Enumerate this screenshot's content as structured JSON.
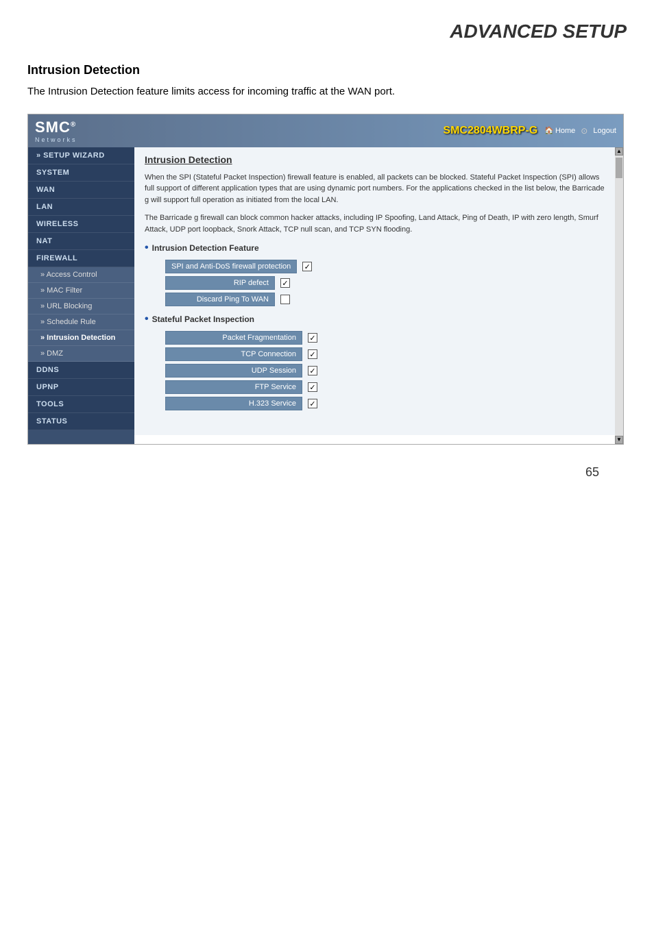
{
  "page": {
    "title": "ADVANCED SETUP",
    "number": "65"
  },
  "intro": {
    "heading": "Intrusion Detection",
    "body": "The Intrusion Detection feature limits access for incoming traffic at the WAN port."
  },
  "router": {
    "brand": "SMC",
    "brand_sup": "®",
    "networks": "Networks",
    "model": "SMC2804WBRP-G",
    "nav_home": "Home",
    "nav_logout": "Logout"
  },
  "sidebar": {
    "items": [
      {
        "id": "setup-wizard",
        "label": "» SETUP WIZARD",
        "type": "section"
      },
      {
        "id": "system",
        "label": "SYSTEM",
        "type": "section"
      },
      {
        "id": "wan",
        "label": "WAN",
        "type": "section"
      },
      {
        "id": "lan",
        "label": "LAN",
        "type": "section"
      },
      {
        "id": "wireless",
        "label": "WIRELESS",
        "type": "section"
      },
      {
        "id": "nat",
        "label": "NAT",
        "type": "section"
      },
      {
        "id": "firewall",
        "label": "FIREWALL",
        "type": "section"
      },
      {
        "id": "access-control",
        "label": "» Access Control",
        "type": "sub"
      },
      {
        "id": "mac-filter",
        "label": "» MAC Filter",
        "type": "sub"
      },
      {
        "id": "url-blocking",
        "label": "» URL Blocking",
        "type": "sub"
      },
      {
        "id": "schedule-rule",
        "label": "» Schedule Rule",
        "type": "sub"
      },
      {
        "id": "intrusion-detection",
        "label": "» Intrusion Detection",
        "type": "sub",
        "active": true
      },
      {
        "id": "dmz",
        "label": "» DMZ",
        "type": "sub"
      },
      {
        "id": "ddns",
        "label": "DDNS",
        "type": "section"
      },
      {
        "id": "upnp",
        "label": "UPnP",
        "type": "section"
      },
      {
        "id": "tools",
        "label": "TOOLS",
        "type": "section"
      },
      {
        "id": "status",
        "label": "STATUS",
        "type": "section"
      }
    ]
  },
  "content": {
    "title": "Intrusion Detection",
    "description1": "When the SPI (Stateful Packet Inspection) firewall feature is enabled, all packets can be blocked. Stateful Packet Inspection (SPI) allows full support of different application types that are using dynamic port numbers. For the applications checked in the list below, the Barricade g will support full operation as initiated from the local LAN.",
    "description2": "The Barricade g firewall can block common hacker attacks, including IP Spoofing, Land Attack, Ping of Death, IP with zero length, Smurf Attack, UDP port loopback, Snork Attack, TCP null scan, and TCP SYN flooding.",
    "section1": {
      "title": "Intrusion Detection Feature",
      "fields": [
        {
          "id": "spi-antidos",
          "label": "SPI and Anti-DoS firewall protection",
          "checked": true
        },
        {
          "id": "rip-defect",
          "label": "RIP defect",
          "checked": true
        },
        {
          "id": "discard-ping",
          "label": "Discard Ping To WAN",
          "checked": false
        }
      ]
    },
    "section2": {
      "title": "Stateful Packet Inspection",
      "fields": [
        {
          "id": "packet-frag",
          "label": "Packet Fragmentation",
          "checked": true
        },
        {
          "id": "tcp-conn",
          "label": "TCP Connection",
          "checked": true
        },
        {
          "id": "udp-session",
          "label": "UDP Session",
          "checked": true
        },
        {
          "id": "ftp-service",
          "label": "FTP Service",
          "checked": true
        },
        {
          "id": "h323-service",
          "label": "H.323 Service",
          "checked": true
        }
      ]
    }
  }
}
